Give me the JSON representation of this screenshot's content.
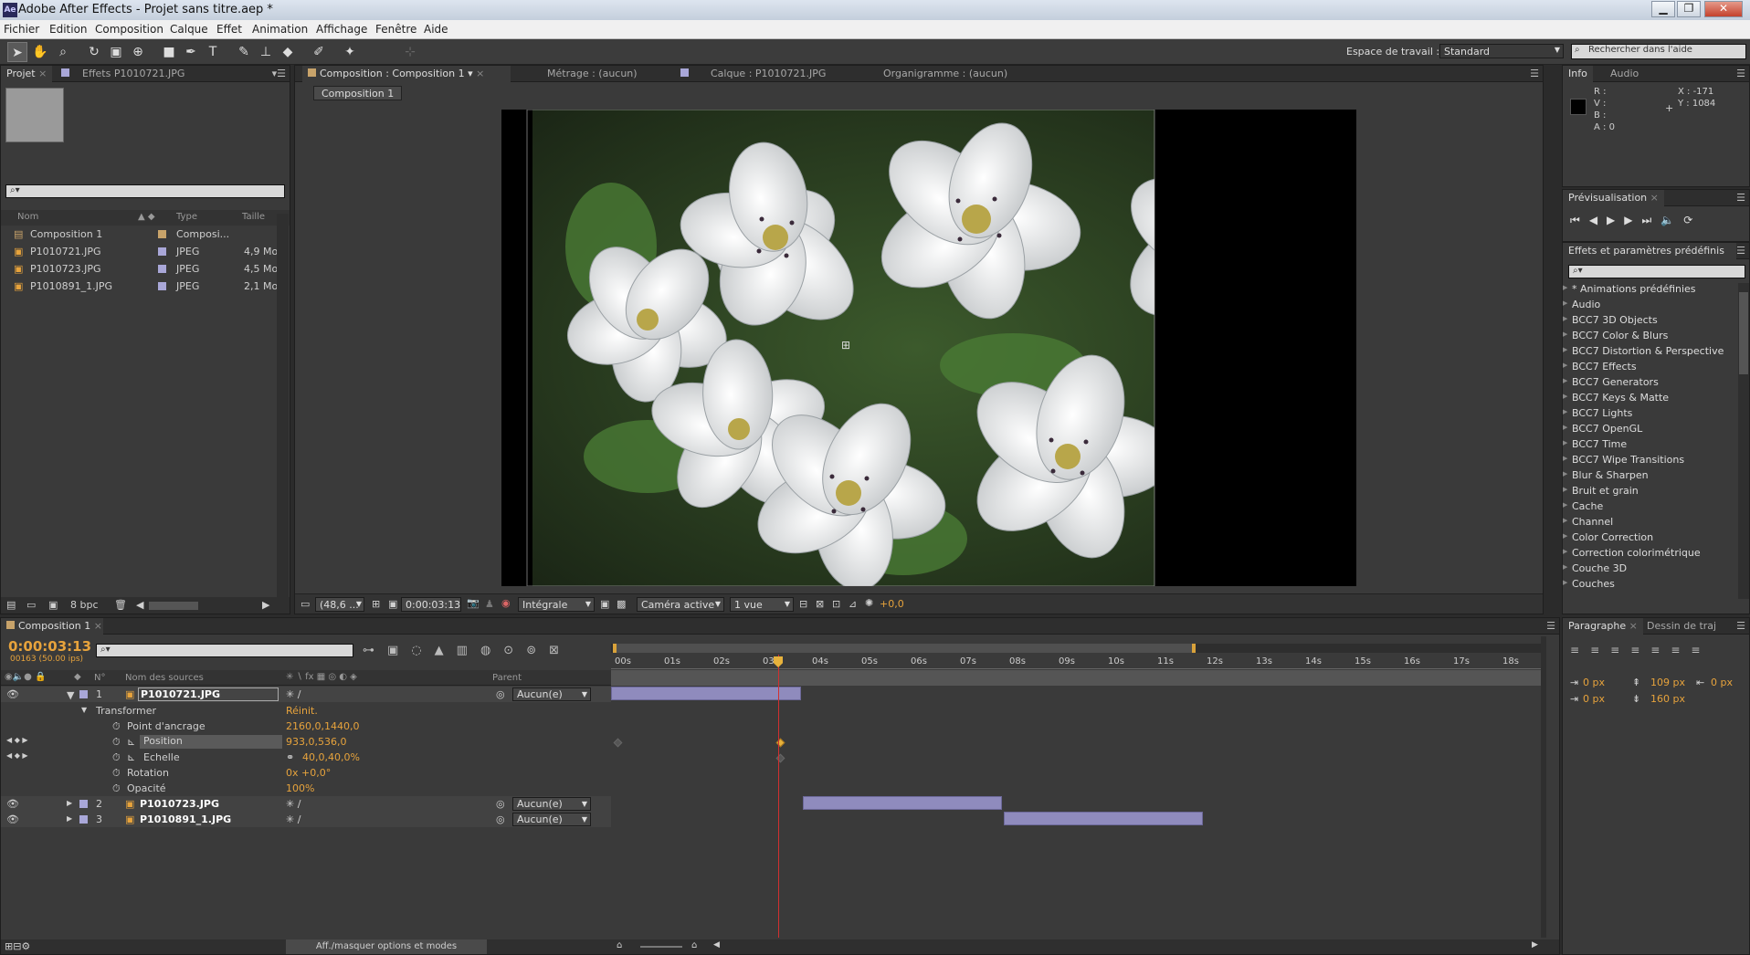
{
  "window": {
    "title": "Adobe After Effects - Projet sans titre.aep *",
    "app_icon": "Ae",
    "controls": [
      "▁",
      "❐",
      "✕"
    ]
  },
  "menu": [
    "Fichier",
    "Edition",
    "Composition",
    "Calque",
    "Effet",
    "Animation",
    "Affichage",
    "Fenêtre",
    "Aide"
  ],
  "toolbar": {
    "workspace_label": "Espace de travail :",
    "workspace_value": "Standard",
    "help_placeholder": "Rechercher dans l'aide"
  },
  "project": {
    "tabs": [
      "Projet",
      "Effets P1010721.JPG"
    ],
    "columns": [
      "Nom",
      "Type",
      "Taille"
    ],
    "items": [
      {
        "name": "Composition 1",
        "type": "Composi...",
        "size": "",
        "color": "#c8a36a"
      },
      {
        "name": "P1010721.JPG",
        "type": "JPEG",
        "size": "4,9 Mo",
        "color": "#a9a7d8"
      },
      {
        "name": "P1010723.JPG",
        "type": "JPEG",
        "size": "4,5 Mo",
        "color": "#a9a7d8"
      },
      {
        "name": "P1010891_1.JPG",
        "type": "JPEG",
        "size": "2,1 Mo",
        "color": "#a9a7d8"
      }
    ],
    "bpc": "8 bpc"
  },
  "viewer": {
    "tabs": [
      "Composition : Composition 1",
      "Métrage : (aucun)",
      "Calque : P1010721.JPG",
      "Organigramme : (aucun)"
    ],
    "subtab": "Composition 1",
    "zoom": "(48,6 ...",
    "timecode": "0:00:03:13",
    "resolution": "Intégrale",
    "camera": "Caméra active",
    "views": "1 vue",
    "exposure": "+0,0"
  },
  "info": {
    "tabs": [
      "Info",
      "Audio"
    ],
    "r": "R :",
    "v": "V :",
    "b": "B :",
    "a": "A : 0",
    "x": "X : -171",
    "y": "Y : 1084"
  },
  "preview": {
    "tab": "Prévisualisation"
  },
  "effects": {
    "tab": "Effets et paramètres prédéfinis",
    "items": [
      "* Animations prédéfinies",
      "Audio",
      "BCC7 3D Objects",
      "BCC7 Color & Blurs",
      "BCC7 Distortion & Perspective",
      "BCC7 Effects",
      "BCC7 Generators",
      "BCC7 Keys & Matte",
      "BCC7 Lights",
      "BCC7 OpenGL",
      "BCC7 Time",
      "BCC7 Wipe Transitions",
      "Blur & Sharpen",
      "Bruit et grain",
      "Cache",
      "Channel",
      "Color Correction",
      "Correction colorimétrique",
      "Couche 3D",
      "Couches"
    ]
  },
  "paragraph": {
    "tabs": [
      "Paragraphe",
      "Dessin de traj"
    ],
    "indent_left": "0 px",
    "indent_first": "0 px",
    "space_before": "109 px",
    "space_after": "160 px",
    "indent_right": "0 px"
  },
  "timeline": {
    "tab": "Composition 1",
    "timecode": "0:00:03:13",
    "frames": "00163 (50.00 ips)",
    "columns": {
      "num": "N°",
      "source": "Nom des sources",
      "parent": "Parent"
    },
    "layers": [
      {
        "num": "1",
        "name": "P1010721.JPG",
        "parent": "Aucun(e)"
      },
      {
        "num": "2",
        "name": "P1010723.JPG",
        "parent": "Aucun(e)"
      },
      {
        "num": "3",
        "name": "P1010891_1.JPG",
        "parent": "Aucun(e)"
      }
    ],
    "transform": {
      "label": "Transformer",
      "reset": "Réinit.",
      "props": [
        {
          "name": "Point d'ancrage",
          "value": "2160,0,1440,0"
        },
        {
          "name": "Position",
          "value": "933,0,536,0"
        },
        {
          "name": "Echelle",
          "value": "40,0,40,0%"
        },
        {
          "name": "Rotation",
          "value": "0x +0,0°"
        },
        {
          "name": "Opacité",
          "value": "100%"
        }
      ]
    },
    "ruler": [
      "00s",
      "01s",
      "02s",
      "03s",
      "04s",
      "05s",
      "06s",
      "07s",
      "08s",
      "09s",
      "10s",
      "11s",
      "12s",
      "13s",
      "14s",
      "15s",
      "16s",
      "17s",
      "18s"
    ],
    "toggle_label": "Aff./masquer options et modes"
  },
  "colors": {
    "accent": "#e7a33c",
    "layer_bar": "#8f8bbd",
    "playhead": "#d03030"
  }
}
